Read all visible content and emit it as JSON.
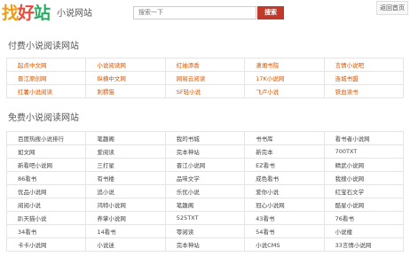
{
  "header": {
    "logo_parts": [
      "找",
      "好",
      "站"
    ],
    "site_name": "小说网站",
    "search_placeholder": "搜索一下",
    "search_button": "搜索",
    "home_link": "返回首页"
  },
  "paid_section": {
    "title": "付费小说阅读网站",
    "rows": [
      [
        "起点中文网",
        "小说阅读网",
        "红袖添香",
        "潇湘书院",
        "言情小说吧"
      ],
      [
        "晋江原创网",
        "纵横中文网",
        "网易云阅读",
        "17K小说网",
        "连城书盟"
      ],
      [
        "红薯小说阅读",
        "刺猬猫",
        "SF轻小说",
        "飞卢小说",
        "铁血读书"
      ]
    ]
  },
  "free_section": {
    "title": "免费小说阅读网站",
    "rows": [
      [
        "百度热搜小说排行",
        "笔趣阁",
        "我的书城",
        "书书库",
        "看书者小说网"
      ],
      [
        "如文网",
        "爱阅读",
        "完本神站",
        "新完本",
        "700TXT"
      ],
      [
        "新看吧小说网",
        "三打星",
        "晋江小说网",
        "EZ看书",
        "精武小说网"
      ],
      [
        "86看书",
        "有书楼",
        "品味文学",
        "成色看书",
        "我搜小说网"
      ],
      [
        "优品小说网",
        "追小说",
        "乐优小说",
        "爱你小说",
        "红宝石文学"
      ],
      [
        "阅阅小说",
        "鸿特小说网",
        "笔趣阁",
        "冠心小说网",
        "酷星小说网"
      ],
      [
        "趴天猫小说",
        "养掌小说网",
        "525TXT",
        "43看书",
        "76看书"
      ],
      [
        "34看书",
        "14看书",
        "零阅读",
        "54看书",
        "小说楼"
      ],
      [
        "卡卡小说网",
        "小说迷",
        "完本神站",
        "小说CMS",
        "33言情小说网"
      ]
    ]
  },
  "colors": {
    "search_button": "#c0392b",
    "paid_link": "#d35400",
    "free_link": "#444444"
  }
}
